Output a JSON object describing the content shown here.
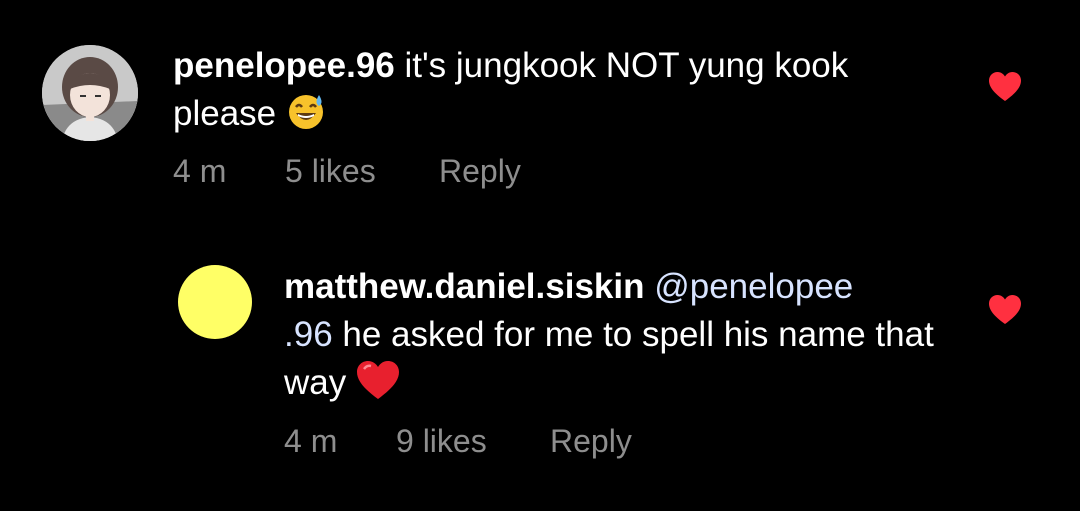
{
  "comments": [
    {
      "username": "penelopee.96",
      "text_before": " it's jungkook NOT yung kook please ",
      "emoji": "sweat-smile-emoji",
      "time": "4 m",
      "likes": "5 likes",
      "reply_label": "Reply",
      "liked": true
    },
    {
      "username": "matthew.daniel.siskin",
      "mention": "@penelopee",
      "mention_cont": ".96",
      "text": " he asked for me to spell his name that way ",
      "emoji": "red-heart-emoji",
      "time": "4 m",
      "likes": "9 likes",
      "reply_label": "Reply",
      "liked": true
    }
  ],
  "colors": {
    "background": "#000000",
    "text": "#ffffff",
    "meta": "#8e8e8e",
    "mention": "#d7e3ff",
    "like": "#ff3040",
    "avatar2": "#ffff66"
  }
}
